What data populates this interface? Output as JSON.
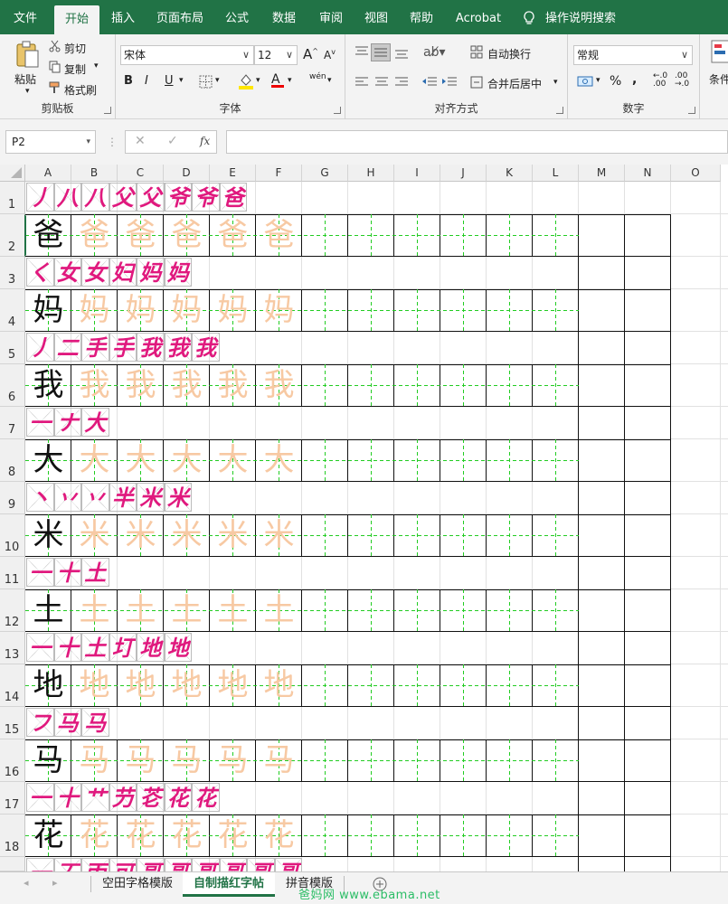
{
  "ribbon_tabs": [
    "文件",
    "开始",
    "插入",
    "页面布局",
    "公式",
    "数据",
    "审阅",
    "视图",
    "帮助",
    "Acrobat",
    "操作说明搜索"
  ],
  "active_tab": "开始",
  "clipboard": {
    "paste": "粘贴",
    "cut": "剪切",
    "copy": "复制",
    "painter": "格式刷",
    "label": "剪贴板"
  },
  "font": {
    "name": "宋体",
    "size": "12",
    "grow": "A",
    "shrink": "A",
    "bold": "B",
    "italic": "I",
    "underline": "U",
    "phonetic": "wén",
    "label": "字体"
  },
  "alignment": {
    "wrap": "自动换行",
    "merge": "合并后居中",
    "label": "对齐方式"
  },
  "number": {
    "format": "常规",
    "percent": "%",
    "comma": ",",
    "inc": "←.0\n.00",
    "label": "数字"
  },
  "styles": {
    "cond": "条件"
  },
  "namebox": "P2",
  "formula_icons": {
    "cancel": "✕",
    "enter": "✓",
    "fx": "fx"
  },
  "columns": [
    "A",
    "B",
    "C",
    "D",
    "E",
    "F",
    "G",
    "H",
    "I",
    "J",
    "K",
    "L",
    "M",
    "N",
    "O"
  ],
  "rows": [
    "1",
    "2",
    "3",
    "4",
    "5",
    "6",
    "7",
    "8",
    "9",
    "10",
    "11",
    "12",
    "13",
    "14",
    "15",
    "16",
    "17",
    "18"
  ],
  "characters": [
    {
      "char": "爸",
      "strokes": [
        "丿",
        "八",
        "八",
        "父",
        "父",
        "爷",
        "爷",
        "爸"
      ]
    },
    {
      "char": "妈",
      "strokes": [
        "く",
        "女",
        "女",
        "妇",
        "妈",
        "妈"
      ]
    },
    {
      "char": "我",
      "strokes": [
        "丿",
        "二",
        "手",
        "手",
        "我",
        "我",
        "我"
      ]
    },
    {
      "char": "大",
      "strokes": [
        "一",
        "ナ",
        "大"
      ]
    },
    {
      "char": "米",
      "strokes": [
        "丶",
        "丷",
        "丷",
        "半",
        "米",
        "米"
      ]
    },
    {
      "char": "土",
      "strokes": [
        "一",
        "十",
        "土"
      ]
    },
    {
      "char": "地",
      "strokes": [
        "一",
        "十",
        "土",
        "圢",
        "地",
        "地"
      ]
    },
    {
      "char": "马",
      "strokes": [
        "フ",
        "马",
        "马"
      ]
    },
    {
      "char": "花",
      "strokes": [
        "一",
        "十",
        "艹",
        "芀",
        "芲",
        "花",
        "花"
      ]
    }
  ],
  "partial_row_strokes": [
    "一",
    "丆",
    "丙",
    "可",
    "哥",
    "哥",
    "哥",
    "哥",
    "哥",
    "哥"
  ],
  "sheet_tabs": [
    "空田字格模版",
    "自制描红字帖",
    "拼音模版"
  ],
  "active_sheet": "自制描红字帖",
  "watermark": "爸妈网 www.ebama.net",
  "colors": {
    "excel_green": "#217346",
    "stroke_pink": "#e0197e",
    "trace_orange": "#f7c9a3",
    "guide_green": "#22cc22"
  }
}
